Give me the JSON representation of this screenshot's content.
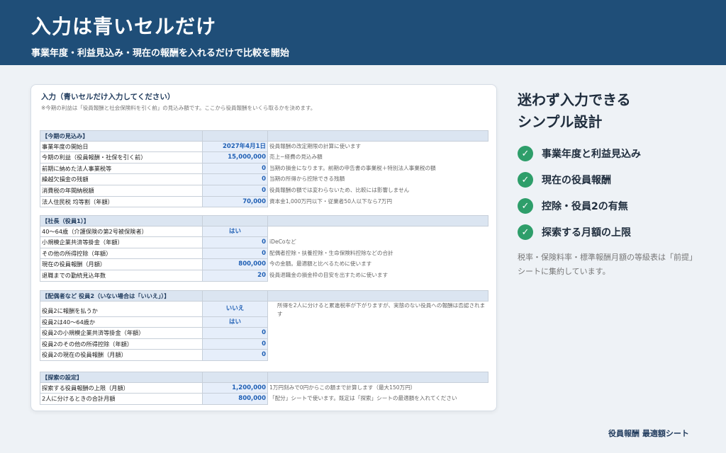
{
  "header": {
    "title": "入力は青いセルだけ",
    "subtitle": "事業年度・利益見込み・現在の報酬を入れるだけで比較を開始"
  },
  "sheet": {
    "title": "入力（青いセルだけ入力してください）",
    "note": "※今期の利益は「役員報酬と社会保険料を引く前」の見込み額です。ここから役員報酬をいくら取るかを決めます。",
    "sections": [
      {
        "heading": "【今期の見込み】",
        "rows": [
          {
            "label": "事業年度の開始日",
            "value": "2027年4月1日",
            "note": "役員報酬の改定期限の計算に使います"
          },
          {
            "label": "今期の利益（役員報酬・社保を引く前）",
            "value": "15,000,000",
            "note": "売上−経費の見込み額"
          },
          {
            "label": "前期に納めた法人事業税等",
            "value": "0",
            "note": "当期の損金になります。前期の申告書の事業税＋特別法人事業税の額"
          },
          {
            "label": "繰越欠損金の残額",
            "value": "0",
            "note": "当期の所得から控除できる残額"
          },
          {
            "label": "消費税の年間納税額",
            "value": "0",
            "note": "役員報酬の額では変わらないため、比較には影響しません"
          },
          {
            "label": "法人住民税 均等割（年額）",
            "value": "70,000",
            "note": "資本金1,000万円以下・従業者50人以下なら7万円"
          }
        ]
      },
      {
        "heading": "【社長（役員1）】",
        "rows": [
          {
            "label": "40〜64歳（介護保険の第2号被保険者）",
            "value": "はい",
            "note": ""
          },
          {
            "label": "小規模企業共済等掛金（年額）",
            "value": "0",
            "note": "iDeCoなど"
          },
          {
            "label": "その他の所得控除（年額）",
            "value": "0",
            "note": "配偶者控除・扶養控除・生命保険料控除などの合計"
          },
          {
            "label": "現在の役員報酬（月額）",
            "value": "800,000",
            "note": "今の金額。最適額と比べるために使います"
          },
          {
            "label": "退職までの勤続見込年数",
            "value": "20",
            "note": "役員退職金の損金枠の目安を出すために使います"
          }
        ]
      },
      {
        "heading": "【配偶者など 役員2（いない場合は「いいえ」）】",
        "wrap_note": "所得を2人に分けると累進税率が下がりますが、実態のない役員への報酬は否認されます",
        "rows": [
          {
            "label": "役員2に報酬を払うか",
            "value": "いいえ",
            "note": ""
          },
          {
            "label": "役員2は40〜64歳か",
            "value": "はい",
            "note": ""
          },
          {
            "label": "役員2の小規模企業共済等掛金（年額）",
            "value": "0",
            "note": ""
          },
          {
            "label": "役員2のその他の所得控除（年額）",
            "value": "0",
            "note": ""
          },
          {
            "label": "役員2の現在の役員報酬（月額）",
            "value": "0",
            "note": ""
          }
        ]
      },
      {
        "heading": "【探索の設定】",
        "rows": [
          {
            "label": "探索する役員報酬の上限（月額）",
            "value": "1,200,000",
            "note": "1万円刻みで0円からこの額まで計算します（最大150万円）"
          },
          {
            "label": "2人に分けるときの合計月額",
            "value": "800,000",
            "note": "「配分」シートで使います。既定は「探索」シートの最適額を入れてください"
          }
        ]
      }
    ]
  },
  "side": {
    "title_line1": "迷わず入力できる",
    "title_line2": "シンプル設計",
    "features": [
      "事業年度と利益見込み",
      "現在の役員報酬",
      "控除・役員2の有無",
      "探索する月額の上限"
    ],
    "note": "税率・保険料率・標準報酬月額の等級表は「前提」シートに集約しています。"
  },
  "footer": "役員報酬 最適額シート",
  "colors": {
    "banner": "#1f4e78",
    "input_cell": "#e6eefa",
    "input_text": "#1f5fb4",
    "check": "#2e9e6a"
  }
}
